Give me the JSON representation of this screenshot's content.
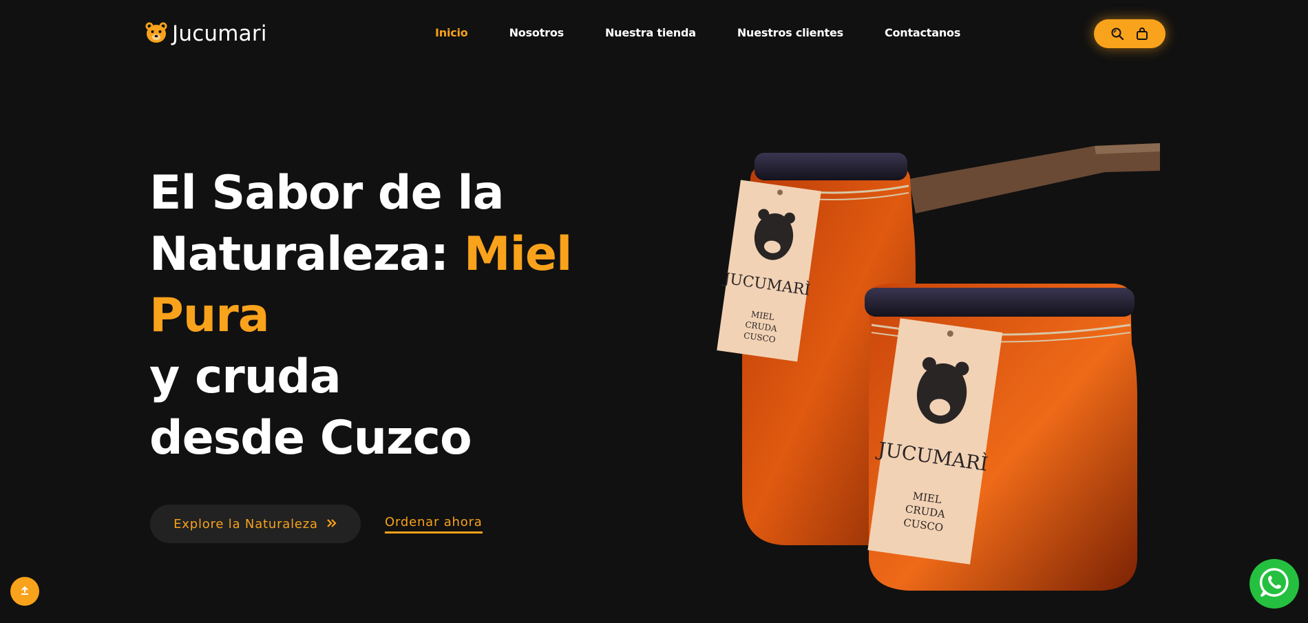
{
  "brand": {
    "name": "Jucumari",
    "logo_icon": "bear-icon",
    "accent_color": "#f9a21b",
    "background_color": "#111111"
  },
  "nav": {
    "items": [
      {
        "label": "Inicio",
        "active": true
      },
      {
        "label": "Nosotros",
        "active": false
      },
      {
        "label": "Nuestra tienda",
        "active": false
      },
      {
        "label": "Nuestros clientes",
        "active": false
      },
      {
        "label": "Contactanos",
        "active": false
      }
    ]
  },
  "header_actions": {
    "search_icon": "search-icon",
    "cart_icon": "shopping-bag-icon"
  },
  "hero": {
    "title_line1": "El Sabor de la",
    "title_line2_white": "Naturaleza: ",
    "title_line2_accent": "Miel",
    "title_line3_accent": "Pura",
    "title_line4": "y cruda",
    "title_line5": "desde Cuzco",
    "primary_button": "Explore la Naturaleza",
    "secondary_link": "Ordenar ahora"
  },
  "product_image": {
    "label_brand": "JUCUMARÌ",
    "label_line1": "MIEL",
    "label_line2": "CRUDA",
    "label_line3": "CUSCO"
  },
  "floating": {
    "scroll_top_icon": "arrow-up-icon",
    "whatsapp_icon": "whatsapp-icon"
  }
}
